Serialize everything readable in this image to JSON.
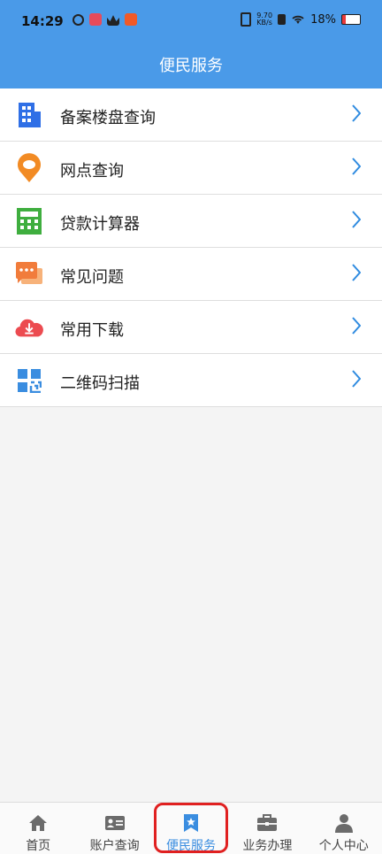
{
  "status_bar": {
    "time": "14:29",
    "network_speed": "9.70\nKB/s",
    "battery": "18%"
  },
  "header": {
    "title": "便民服务"
  },
  "menu": {
    "items": [
      {
        "label": "备案楼盘查询",
        "icon": "building-icon"
      },
      {
        "label": "网点查询",
        "icon": "location-pin-icon"
      },
      {
        "label": "贷款计算器",
        "icon": "calculator-icon"
      },
      {
        "label": "常见问题",
        "icon": "chat-bubbles-icon"
      },
      {
        "label": "常用下载",
        "icon": "cloud-download-icon"
      },
      {
        "label": "二维码扫描",
        "icon": "qr-code-icon"
      }
    ]
  },
  "bottom_nav": {
    "tabs": [
      {
        "label": "首页",
        "icon": "home-icon"
      },
      {
        "label": "账户查询",
        "icon": "id-card-icon"
      },
      {
        "label": "便民服务",
        "icon": "bookmark-star-icon",
        "active": true
      },
      {
        "label": "业务办理",
        "icon": "briefcase-icon"
      },
      {
        "label": "个人中心",
        "icon": "user-icon"
      }
    ]
  },
  "colors": {
    "header_bg": "#4a9ae8",
    "accent": "#3a8de0",
    "chevron": "#2f8be0",
    "highlight": "#e02020"
  }
}
